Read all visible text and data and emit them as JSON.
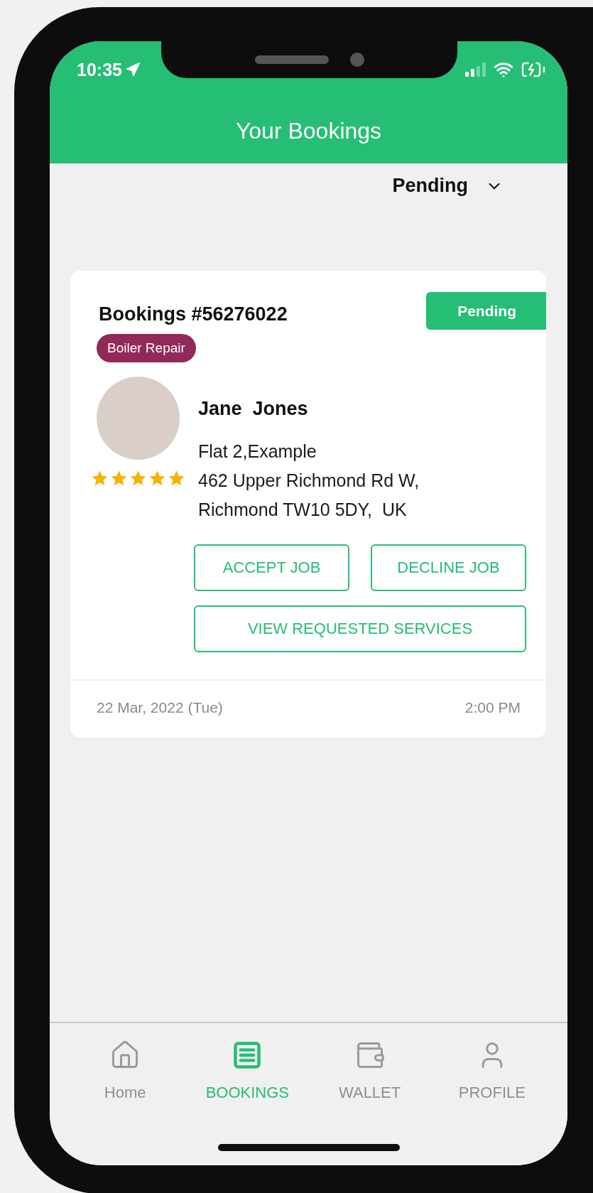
{
  "status_bar": {
    "time": "10:35"
  },
  "header": {
    "title": "Your Bookings"
  },
  "filter": {
    "label": "Pending"
  },
  "booking": {
    "number": "Bookings #56276022",
    "status": "Pending",
    "service": "Boiler Repair",
    "customer": {
      "name": "Jane  Jones",
      "stars": 5,
      "address": [
        "Flat 2,Example",
        "462 Upper Richmond Rd W,",
        "Richmond TW10 5DY,  UK"
      ]
    },
    "actions": [
      {
        "label": "ACCEPT JOB",
        "kind": "half"
      },
      {
        "label": "DECLINE JOB",
        "kind": "half"
      },
      {
        "label": "VIEW REQUESTED SERVICES",
        "kind": "full"
      }
    ],
    "date": "22 Mar, 2022 (Tue)",
    "time": "2:00 PM"
  },
  "nav": {
    "items": [
      {
        "label": "Home",
        "kind": "home",
        "selected": false
      },
      {
        "label": "BOOKINGS",
        "kind": "bookings",
        "selected": true
      },
      {
        "label": "WALLET",
        "kind": "wallet",
        "selected": false
      },
      {
        "label": "PROFILE",
        "kind": "profile",
        "selected": false
      }
    ]
  }
}
